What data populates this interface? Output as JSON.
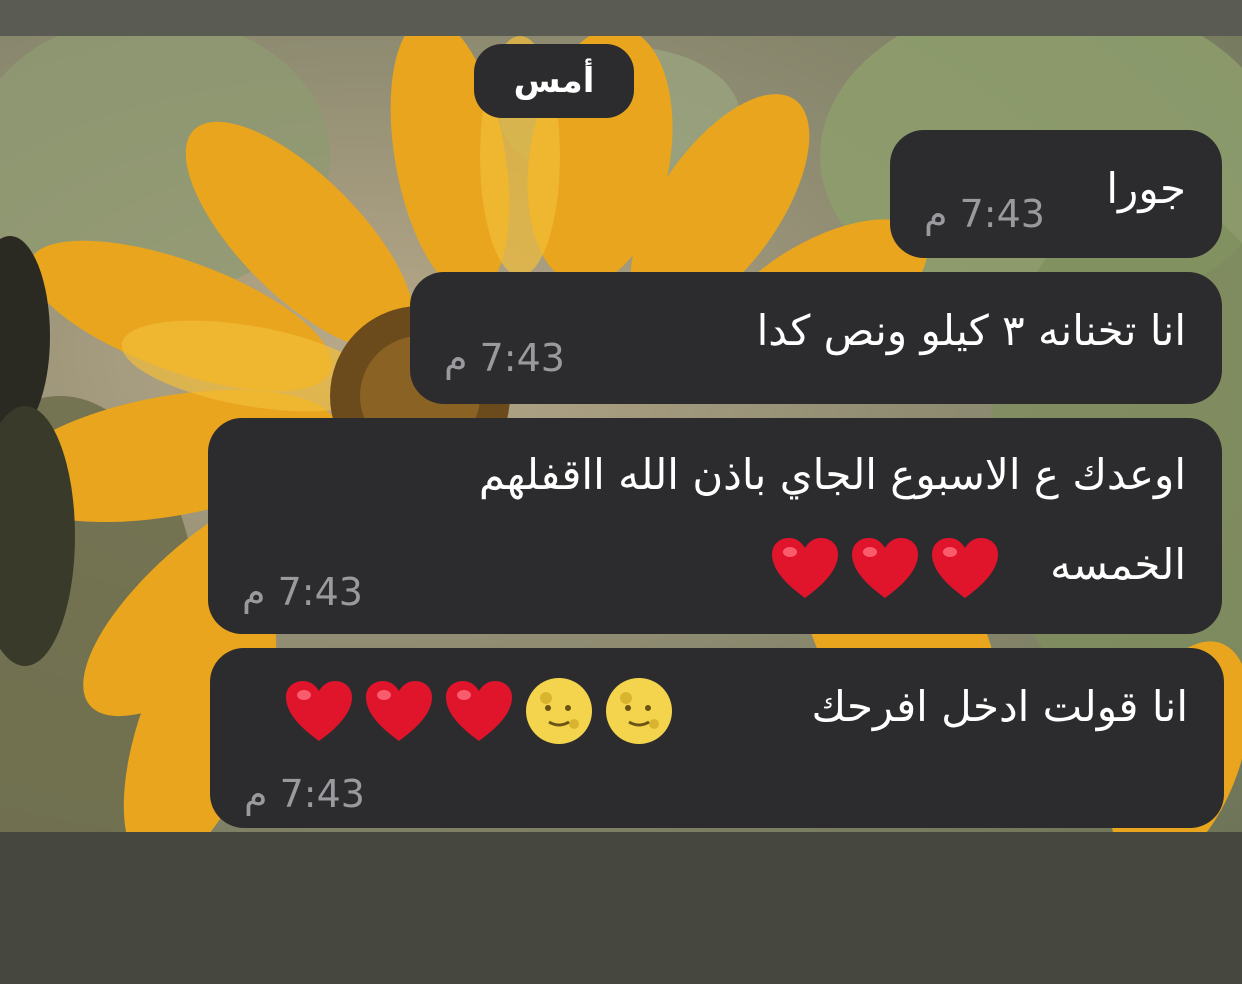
{
  "date_chip": "أمس",
  "messages": [
    {
      "text": "جورا",
      "time": "7:43 م"
    },
    {
      "text": "انا تخنانه ٣ كيلو ونص كدا",
      "time": "7:43 م"
    },
    {
      "line1": "اوعدك ع الاسبوع الجاي باذن الله ااقفلهم",
      "line2": "الخمسه",
      "time": "7:43 م",
      "emojis": [
        "heart",
        "heart",
        "heart"
      ]
    },
    {
      "text": "انا قولت ادخل افرحك",
      "time": "7:43 م",
      "emojis": [
        "full-moon-face",
        "full-moon-face",
        "heart",
        "heart",
        "heart"
      ]
    }
  ],
  "colors": {
    "bubble": "#2c2c2e",
    "text": "#ffffff",
    "timestamp": "#9a9a9e",
    "heart": "#e0142a",
    "moon": "#f3d44c"
  }
}
